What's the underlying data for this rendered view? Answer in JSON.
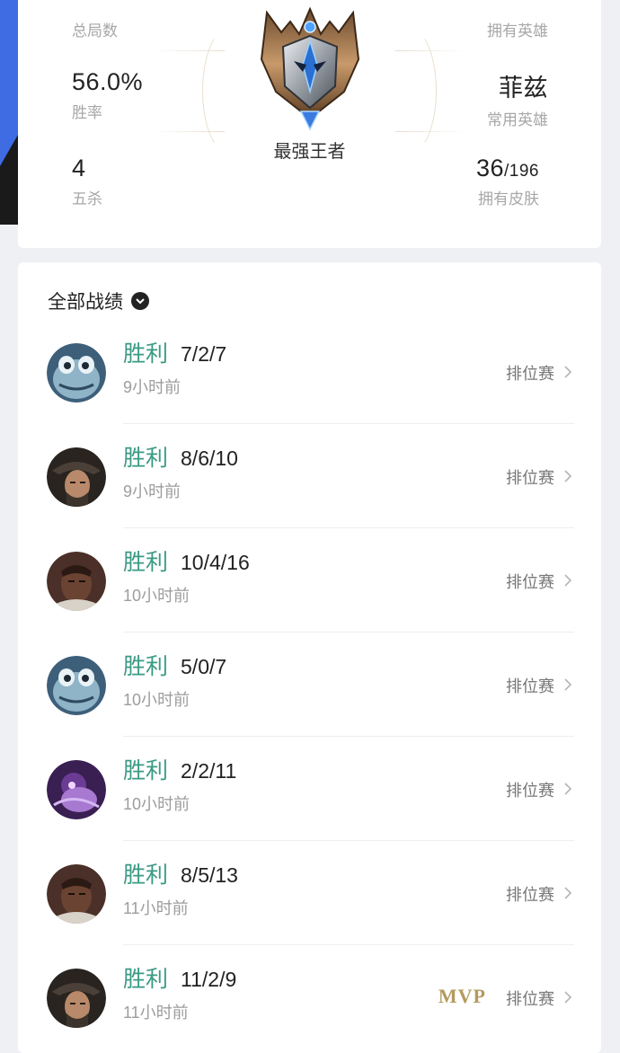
{
  "stats": {
    "total_games_label": "总局数",
    "win_rate_value": "56.0%",
    "win_rate_label": "胜率",
    "penta_value": "4",
    "penta_label": "五杀",
    "owned_heroes_label": "拥有英雄",
    "main_hero_value": "菲兹",
    "main_hero_label": "常用英雄",
    "skins_owned": "36",
    "skins_total": "/196",
    "skins_label": "拥有皮肤"
  },
  "rank": {
    "name": "最强王者",
    "emblem_icon": "challenger-emblem-icon"
  },
  "records": {
    "title": "全部战绩",
    "dropdown_icon": "chevron-down-circle-icon",
    "matches": [
      {
        "result": "胜利",
        "kda": "7/2/7",
        "time": "9小时前",
        "mode": "排位赛",
        "mvp": "",
        "avatar": "fizz-avatar"
      },
      {
        "result": "胜利",
        "kda": "8/6/10",
        "time": "9小时前",
        "mode": "排位赛",
        "mvp": "",
        "avatar": "twisted-fate-avatar"
      },
      {
        "result": "胜利",
        "kda": "10/4/16",
        "time": "10小时前",
        "mode": "排位赛",
        "mvp": "",
        "avatar": "lucian-avatar"
      },
      {
        "result": "胜利",
        "kda": "5/0/7",
        "time": "10小时前",
        "mode": "排位赛",
        "mvp": "",
        "avatar": "fizz-avatar"
      },
      {
        "result": "胜利",
        "kda": "2/2/11",
        "time": "10小时前",
        "mode": "排位赛",
        "mvp": "",
        "avatar": "purple-champion-avatar"
      },
      {
        "result": "胜利",
        "kda": "8/5/13",
        "time": "11小时前",
        "mode": "排位赛",
        "mvp": "",
        "avatar": "lucian-avatar"
      },
      {
        "result": "胜利",
        "kda": "11/2/9",
        "time": "11小时前",
        "mode": "排位赛",
        "mvp": "MVP",
        "avatar": "twisted-fate-avatar"
      }
    ]
  },
  "colors": {
    "win": "#3a9a84",
    "accent_edge": "#3f6be3",
    "mvp": "#b39a5e"
  }
}
